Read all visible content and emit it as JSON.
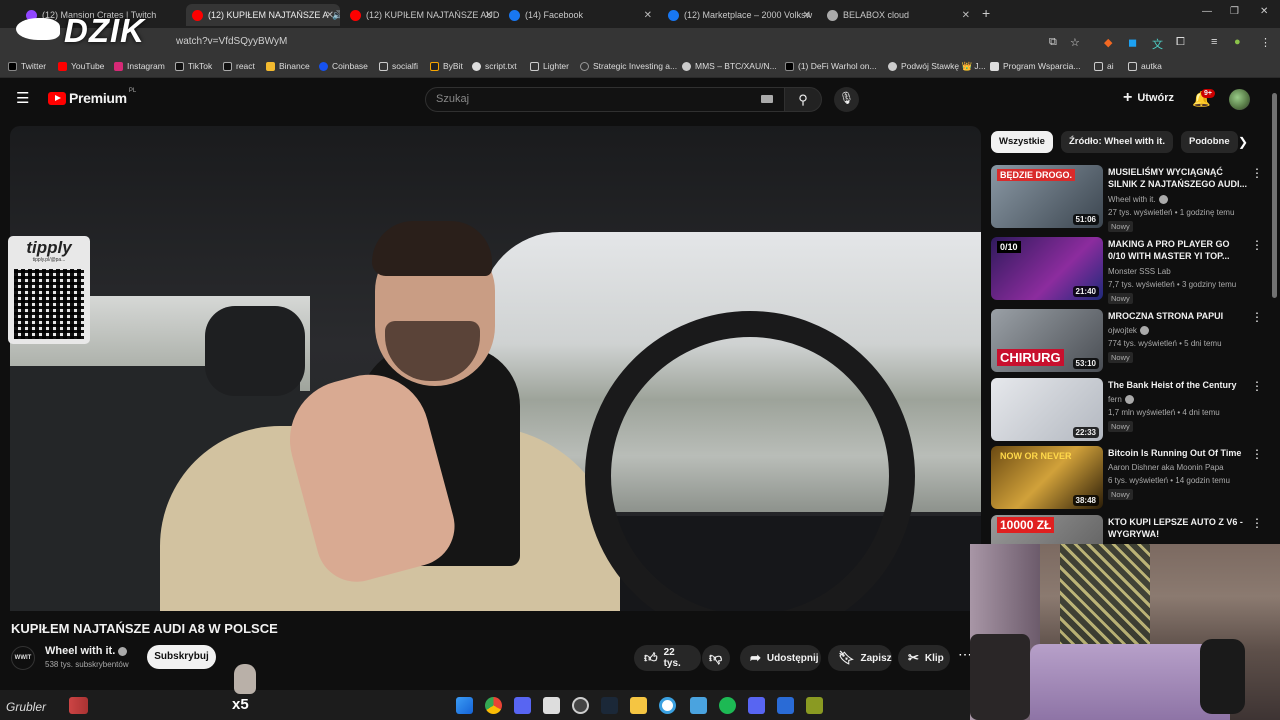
{
  "browser": {
    "tabs": [
      {
        "label": "(12) Mansion Crates | Twitch",
        "color": "#9146ff"
      },
      {
        "label": "(12) KUPIŁEM NAJTAŃSZE A",
        "color": "#ff0000"
      },
      {
        "label": "(12) KUPIŁEM NAJTAŃSZE AUDI",
        "color": "#ff0000"
      },
      {
        "label": "(14) Facebook",
        "color": "#1877f2"
      },
      {
        "label": "(12) Marketplace – 2000 Volksw",
        "color": "#1877f2"
      },
      {
        "label": "BELABOX cloud",
        "color": "#aaaaaa"
      }
    ],
    "url": "watch?v=VfdSQyyBWyM",
    "overlay_logo": "DZIK",
    "bookmarks": [
      {
        "label": "Twitter",
        "icon": "x-icon"
      },
      {
        "label": "YouTube",
        "icon": "youtube-icon"
      },
      {
        "label": "Instagram",
        "icon": "instagram-icon"
      },
      {
        "label": "TikTok",
        "icon": "tiktok-icon"
      },
      {
        "label": "react",
        "icon": "tiktok-icon"
      },
      {
        "label": "Binance",
        "icon": "binance-icon"
      },
      {
        "label": "Coinbase",
        "icon": "coinbase-icon"
      },
      {
        "label": "socialfi",
        "icon": "folder-icon"
      },
      {
        "label": "ByBit",
        "icon": "bybit-icon"
      },
      {
        "label": "script.txt",
        "icon": "github-icon"
      },
      {
        "label": "Lighter",
        "icon": "lighter-icon"
      },
      {
        "label": "Strategic Investing a...",
        "icon": "loading-icon"
      },
      {
        "label": "MMS – BTC/XAU/N...",
        "icon": "globe-icon"
      },
      {
        "label": "(1) DeFi Warhol on...",
        "icon": "x-icon"
      },
      {
        "label": "Podwój Stawkę 👑 J...",
        "icon": "globe-icon"
      },
      {
        "label": "Program Wsparcia...",
        "icon": "bookmark-icon"
      },
      {
        "label": "ai",
        "icon": "folder-icon"
      },
      {
        "label": "autka",
        "icon": "folder-icon"
      }
    ]
  },
  "youtube": {
    "logo_text": "Premium",
    "logo_region": "PL",
    "search_placeholder": "Szukaj",
    "create_label": "Utwórz",
    "notifications_badge": "9+"
  },
  "video": {
    "title": "KUPIŁEM NAJTAŃSZE AUDI A8 W POLSCE",
    "overlay_brand": "tipply",
    "overlay_url": "tipply.pl/@pa...",
    "channel": "Wheel with it.",
    "channel_avatar_text": "WWIT",
    "subscribers": "538 tys. subskrybentów",
    "subscribe_label": "Subskrybuj",
    "likes": "22 tys.",
    "share_label": "Udostępnij",
    "save_label": "Zapisz",
    "clip_label": "Klip"
  },
  "sidebar": {
    "chips": [
      "Wszystkie",
      "Źródło: Wheel with it.",
      "Podobne"
    ],
    "recommendations": [
      {
        "title": "MUSIELIŚMY WYCIĄGNĄĆ SILNIK Z NAJTAŃSZEGO AUDI...",
        "channel": "Wheel with it.",
        "meta": "27 tys. wyświetleń • 1 godzinę temu",
        "badge": "Nowy",
        "duration": "51:06",
        "thumb_text": "BĘDZIE DROGO.",
        "thumb_color": "#5b6a76"
      },
      {
        "title": "MAKING A PRO PLAYER GO 0/10 WITH MASTER YI TOP...",
        "channel": "Monster SSS Lab",
        "meta": "7,7 tys. wyświetleń • 3 godziny temu",
        "badge": "Nowy",
        "duration": "21:40",
        "thumb_text": "0/10",
        "thumb_color": "#4b2a7a"
      },
      {
        "title": "MROCZNA STRONA PAPUI",
        "channel": "ojwojtek",
        "meta": "774 tys. wyświetleń • 5 dni temu",
        "badge": "Nowy",
        "duration": "53:10",
        "thumb_text": "CHIRURG",
        "thumb_color": "#6a6e74"
      },
      {
        "title": "The Bank Heist of the Century",
        "channel": "fern",
        "meta": "1,7 mln wyświetleń • 4 dni temu",
        "badge": "Nowy",
        "duration": "22:33",
        "thumb_text": "",
        "thumb_color": "#c9cdd4"
      },
      {
        "title": "Bitcoin Is Running Out Of Time",
        "channel": "Aaron Dishner aka Moonin Papa",
        "meta": "6 tys. wyświetleń • 14 godzin temu",
        "badge": "Nowy",
        "duration": "38:48",
        "thumb_text": "NOW OR NEVER",
        "thumb_color": "#3a2a12"
      },
      {
        "title": "KTO KUPI LEPSZE AUTO Z V6 - WYGRYWA!",
        "channel": "",
        "meta": "",
        "badge": "",
        "duration": "",
        "thumb_text": "10000 ZŁ",
        "thumb_color": "#7d7d7d"
      }
    ]
  },
  "stream_overlay": {
    "name": "Grubler",
    "multiplier": "x5"
  }
}
